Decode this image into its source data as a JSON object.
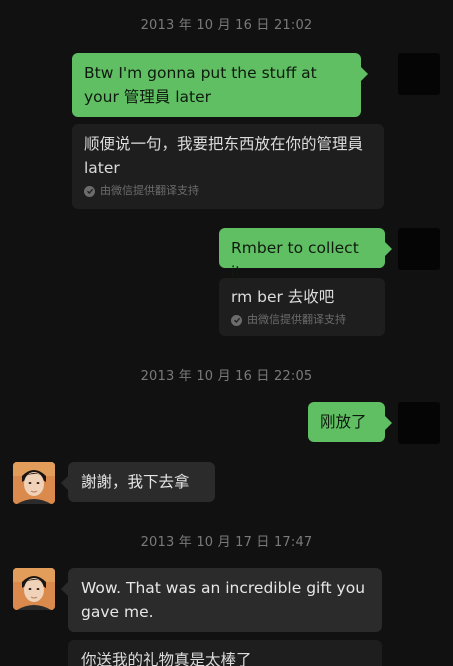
{
  "messages": {
    "ts1": "2013 年 10 月 16 日 21:02",
    "m1_text": "Btw I'm gonna put the stuff at your 管理員 later",
    "m1_translation": "顺便说一句，我要把东西放在你的管理員 later",
    "translation_note": "由微信提供翻译支持",
    "m2_text": "Rmber to collect it",
    "m2_translation": "rm ber 去收吧",
    "ts2": "2013 年 10 月 16 日 22:05",
    "m3_text": "刚放了",
    "m4_text": "謝謝，我下去拿",
    "ts3": "2013 年 10 月 17 日 17:47",
    "m5_text": "Wow. That was an incredible gift you gave me.",
    "m5_translation": "你送我的礼物真是太棒了"
  },
  "colors": {
    "background": "#111111",
    "outgoing_bubble": "#5fbf62",
    "incoming_bubble": "#2b2b2b",
    "translation_bubble": "#1e1e1e",
    "timestamp_text": "#7a7a7a"
  },
  "icons": {
    "verified": "check-circle-icon",
    "friend_avatar": "avatar",
    "self_avatar": "avatar"
  }
}
